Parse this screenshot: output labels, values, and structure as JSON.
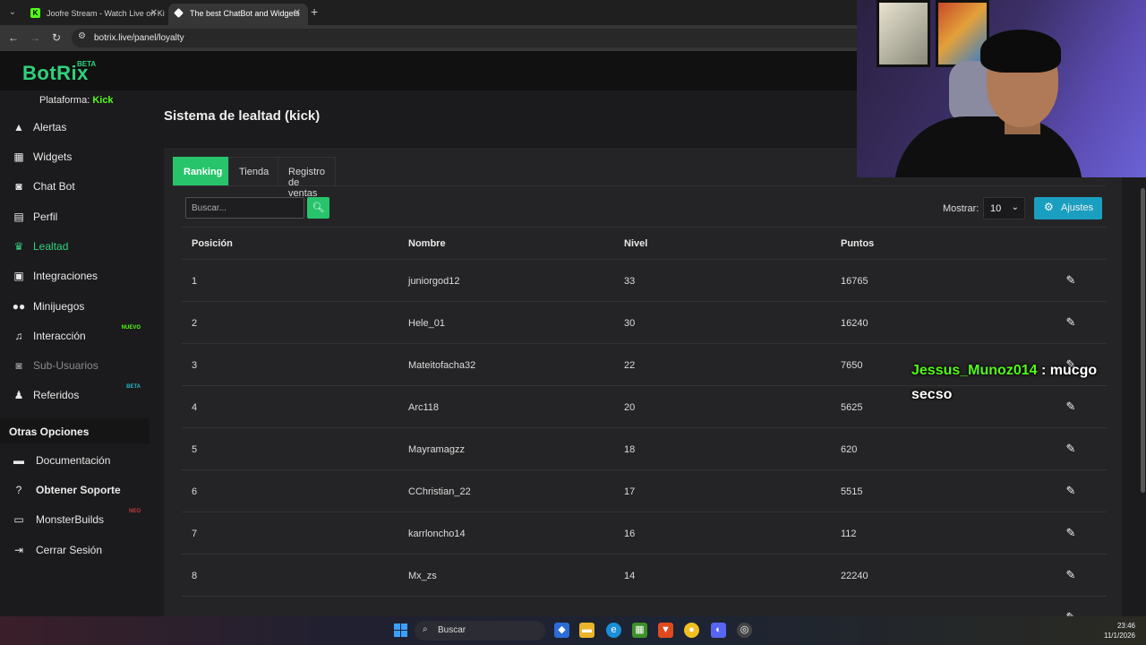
{
  "browser": {
    "tabs": [
      {
        "title": "Joofre Stream - Watch Live on Kick",
        "active": false
      },
      {
        "title": "The best ChatBot and Widgets",
        "active": true
      }
    ],
    "url": "botrix.live/panel/loyalty"
  },
  "sidebar": {
    "logo": "BotRix",
    "logo_badge": "BETA",
    "platform_label": "Plataforma:",
    "platform_value": "Kick",
    "items": [
      {
        "label": "Alertas",
        "icon": "warning-icon"
      },
      {
        "label": "Widgets",
        "icon": "grid-icon"
      },
      {
        "label": "Chat Bot",
        "icon": "robot-icon"
      },
      {
        "label": "Perfil",
        "icon": "id-card-icon"
      },
      {
        "label": "Lealtad",
        "icon": "trophy-icon",
        "active": true
      },
      {
        "label": "Integraciones",
        "icon": "plug-icon"
      },
      {
        "label": "Minijuegos",
        "icon": "gamepad-icon"
      },
      {
        "label": "Interacción",
        "icon": "music-icon",
        "badge": "NUEVO"
      },
      {
        "label": "Sub-Usuarios",
        "icon": "robot-icon",
        "disabled": true
      },
      {
        "label": "Referidos",
        "icon": "users-icon",
        "badge": "BETA"
      }
    ],
    "other_title": "Otras Opciones",
    "other_items": [
      {
        "label": "Documentación",
        "icon": "scroll-icon"
      },
      {
        "label": "Obtener Soporte",
        "icon": "question-icon"
      },
      {
        "label": "MonsterBuilds",
        "icon": "laptop-icon",
        "badge": "NEO"
      },
      {
        "label": "Cerrar Sesión",
        "icon": "sign-out-icon"
      }
    ]
  },
  "main": {
    "title": "Sistema de lealtad (kick)",
    "tabs": [
      "Ranking",
      "Tienda",
      "Registro de ventas"
    ],
    "search_placeholder": "Buscar...",
    "show_label": "Mostrar:",
    "show_value": "10",
    "settings_label": "Ajustes",
    "columns": [
      "Posición",
      "Nombre",
      "Nivel",
      "Puntos"
    ],
    "rows": [
      {
        "pos": "1",
        "name": "juniorgod12",
        "level": "33",
        "points": "16765"
      },
      {
        "pos": "2",
        "name": "Hele_01",
        "level": "30",
        "points": "16240"
      },
      {
        "pos": "3",
        "name": "Mateitofacha32",
        "level": "22",
        "points": "7650"
      },
      {
        "pos": "4",
        "name": "Arc118",
        "level": "20",
        "points": "5625"
      },
      {
        "pos": "5",
        "name": "Mayramagzz",
        "level": "18",
        "points": "620"
      },
      {
        "pos": "6",
        "name": "CChristian_22",
        "level": "17",
        "points": "5515"
      },
      {
        "pos": "7",
        "name": "karrloncho14",
        "level": "16",
        "points": "112"
      },
      {
        "pos": "8",
        "name": "Mx_zs",
        "level": "14",
        "points": "22240"
      }
    ]
  },
  "overlay": {
    "chat_user": "Jessus_Munoz014",
    "chat_sep": " : ",
    "chat_text": "mucgo secso"
  },
  "taskbar": {
    "search_label": "Buscar",
    "time": "23:46",
    "date": "11/1/2026"
  },
  "colors": {
    "accent": "#27c46b",
    "kick": "#53fc18",
    "settings": "#1a9fc0"
  }
}
